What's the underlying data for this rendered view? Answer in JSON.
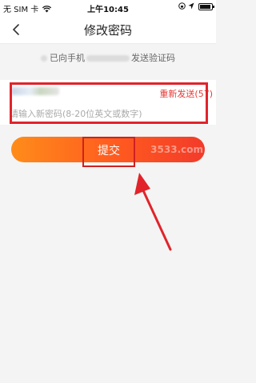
{
  "status_bar": {
    "carrier": "无 SIM 卡",
    "time": "上午10:45",
    "icons": [
      "wifi-icon",
      "lock-rotation-icon",
      "location-icon",
      "battery-icon"
    ]
  },
  "nav": {
    "title": "修改密码",
    "back_icon": "chevron-left-icon"
  },
  "notice": {
    "prefix": "已向手机",
    "suffix": "发送验证码"
  },
  "form": {
    "code": {
      "value": "",
      "resend_label": "重新发送(57)"
    },
    "password": {
      "placeholder": "请输入新密码(8-20位英文或数字)"
    }
  },
  "submit": {
    "label": "提交"
  },
  "watermark": "3533.com",
  "colors": {
    "accent_red": "#e53935",
    "button_gradient_start": "#ff8c1a",
    "button_gradient_end": "#f23b2a",
    "highlight": "#e0242a"
  }
}
